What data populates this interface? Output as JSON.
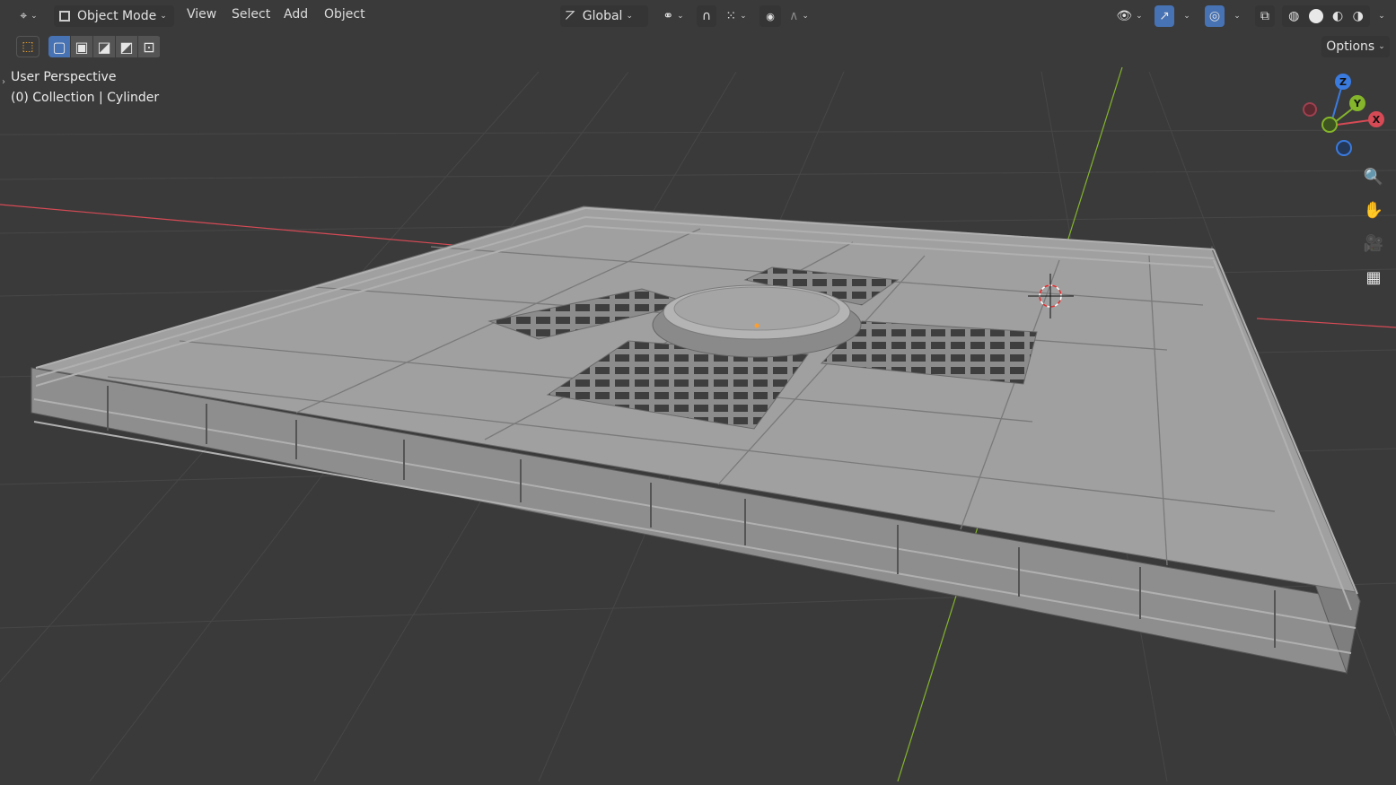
{
  "header": {
    "mode_label": "Object Mode",
    "menus": [
      "View",
      "Select",
      "Add",
      "Object"
    ],
    "orientation_label": "Global",
    "options_label": "Options"
  },
  "overlay": {
    "view_name": "User Perspective",
    "collection_info": "(0) Collection | Cylinder"
  },
  "gizmo": {
    "z_label": "Z",
    "y_label": "Y",
    "x_label": "X"
  },
  "colors": {
    "background": "#3a3a3a",
    "x_axis": "#d64a55",
    "y_axis": "#84b52b",
    "z_axis": "#3a7be0",
    "active_tool": "#4772b3",
    "mesh": "#9a9a9a"
  },
  "icons": {
    "editor_type": "editor-type-icon",
    "select_box": "select-box-icon",
    "zoom": "zoom-icon",
    "pan": "hand-icon",
    "camera": "camera-icon",
    "grid_view": "perspective-grid-icon"
  }
}
